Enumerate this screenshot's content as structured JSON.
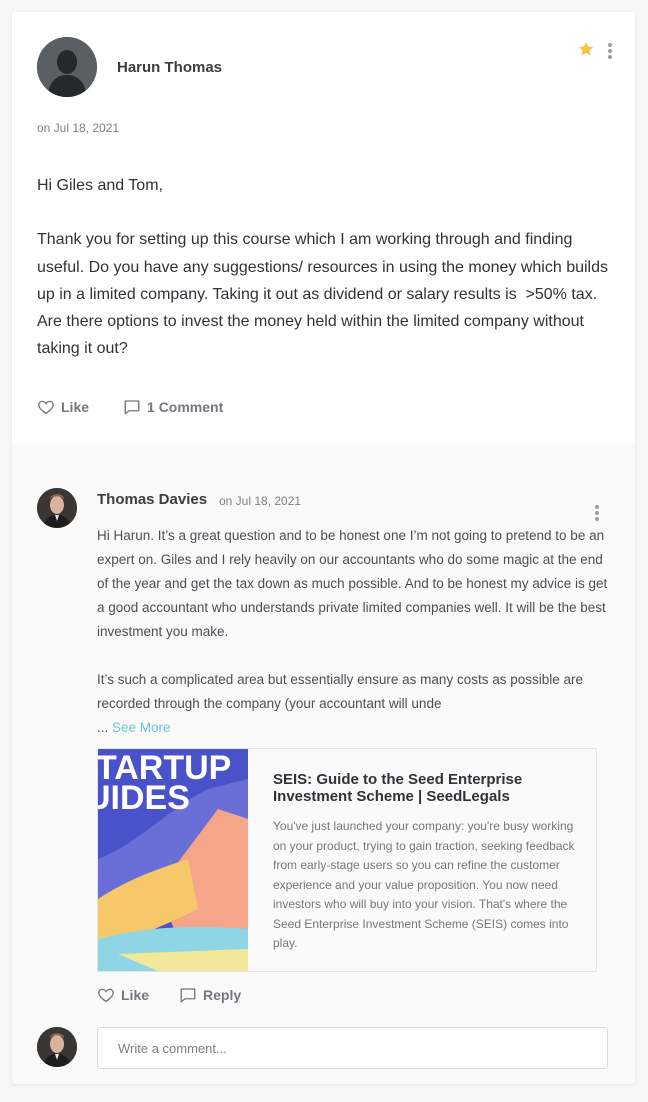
{
  "post": {
    "author": "Harun Thomas",
    "date": "on Jul 18, 2021",
    "body": [
      "Hi Giles and Tom,",
      "",
      "Thank you for setting up this course which I am working through and finding useful. Do you have any suggestions/ resources in using the money which builds up in a limited company. Taking it out as dividend or salary results is  >50% tax. Are there options to invest the money held within the limited company without taking it out?"
    ],
    "actions": {
      "like_label": "Like",
      "comments_label": "1 Comment"
    },
    "icons": {
      "star": "star-icon",
      "menu": "more-vertical-icon"
    },
    "colors": {
      "star": "#f6c344"
    }
  },
  "comment": {
    "author": "Thomas Davies",
    "date": "on Jul 18, 2021",
    "body": [
      "Hi Harun. It’s a great question and to be honest one I’m not going to pretend to be an expert on. Giles and I rely heavily on our accountants who do some magic at the end of the year and get the tax down as much possible. And to be honest my advice is get a good accountant who understands private limited companies well. It will be the best investment you make.",
      "",
      "It’s such a complicated area but essentially ensure as many costs as possible are recorded through the company (your accountant will unde"
    ],
    "ellipsis": "...",
    "see_more": "See More",
    "link_preview": {
      "thumb_text": [
        "TARTUP",
        "UIDES"
      ],
      "title": "SEIS: Guide to the Seed Enterprise Investment Scheme | SeedLegals",
      "description": "You've just launched your company: you're busy working on your product, trying to gain traction, seeking feedback from early-stage users so you can refine the customer experience and your value proposition. You now need investors who will buy into your vision. That's where the Seed Enterprise Investment Scheme (SEIS) comes into play."
    },
    "actions": {
      "like_label": "Like",
      "reply_label": "Reply"
    }
  },
  "composer": {
    "placeholder": "Write a comment..."
  }
}
